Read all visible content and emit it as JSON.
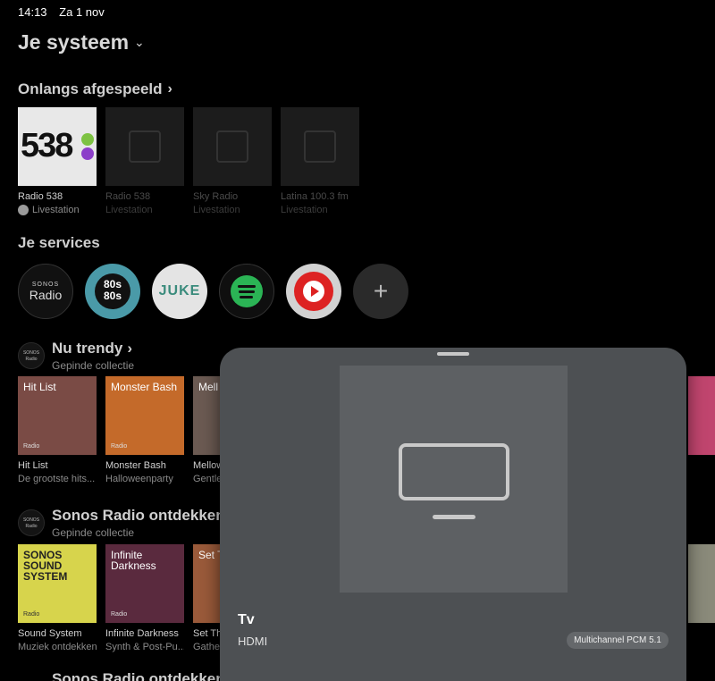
{
  "status": {
    "time": "14:13",
    "date": "Za 1 nov"
  },
  "header": {
    "title": "Je systeem"
  },
  "recent": {
    "heading": "Onlangs afgespeeld",
    "items": [
      {
        "name": "Radio 538",
        "sub": "Livestation",
        "art_text": "538"
      },
      {
        "name": "Radio 538",
        "sub": "Livestation"
      },
      {
        "name": "Sky Radio",
        "sub": "Livestation"
      },
      {
        "name": "Latina 100.3 fm",
        "sub": "Livestation"
      }
    ]
  },
  "services": {
    "heading": "Je services",
    "items": [
      {
        "name": "sonos-radio",
        "line1": "SONOS",
        "line2": "Radio"
      },
      {
        "name": "80s-80s",
        "line1": "80s",
        "line2": "80s"
      },
      {
        "name": "juke",
        "line1": "JUKE"
      },
      {
        "name": "spotify"
      },
      {
        "name": "youtube-music"
      },
      {
        "name": "add-service"
      }
    ]
  },
  "trendy": {
    "logo": "SONOS Radio",
    "title": "Nu trendy",
    "subtitle": "Gepinde collectie",
    "items": [
      {
        "name": "Hit List",
        "sub": "De grootste hits...",
        "cap": "Hit List",
        "color": "#7a4b45"
      },
      {
        "name": "Monster Bash",
        "sub": "Halloweenparty",
        "cap": "Monster Bash",
        "color": "#c46a2a"
      },
      {
        "name": "Mellow",
        "sub": "Gentle",
        "cap": "Mell Mor",
        "color": "#6b5a52"
      }
    ]
  },
  "discover": {
    "logo": "SONOS Radio",
    "title": "Sonos Radio ontdekken",
    "subtitle": "Gepinde collectie",
    "items": [
      {
        "name": "Sound System",
        "sub": "Muziek ontdekken",
        "cap": "SONOS SOUND SYSTEM",
        "color": "#d7d44c"
      },
      {
        "name": "Infinite Darkness",
        "sub": "Synth & Post-Pu...",
        "cap": "Infinite Darkness",
        "color": "#5a2a3e"
      },
      {
        "name": "Set Th",
        "sub": "Gathe",
        "cap": "Set Tabl",
        "color": "#9a5a3a"
      }
    ]
  },
  "more_heading": "Sonos Radio ontdekken",
  "cover_labels": {
    "radio": "Radio",
    "sonos": "SONOS"
  },
  "sheet": {
    "title": "Tv",
    "source": "HDMI",
    "format": "Multichannel PCM 5.1"
  }
}
